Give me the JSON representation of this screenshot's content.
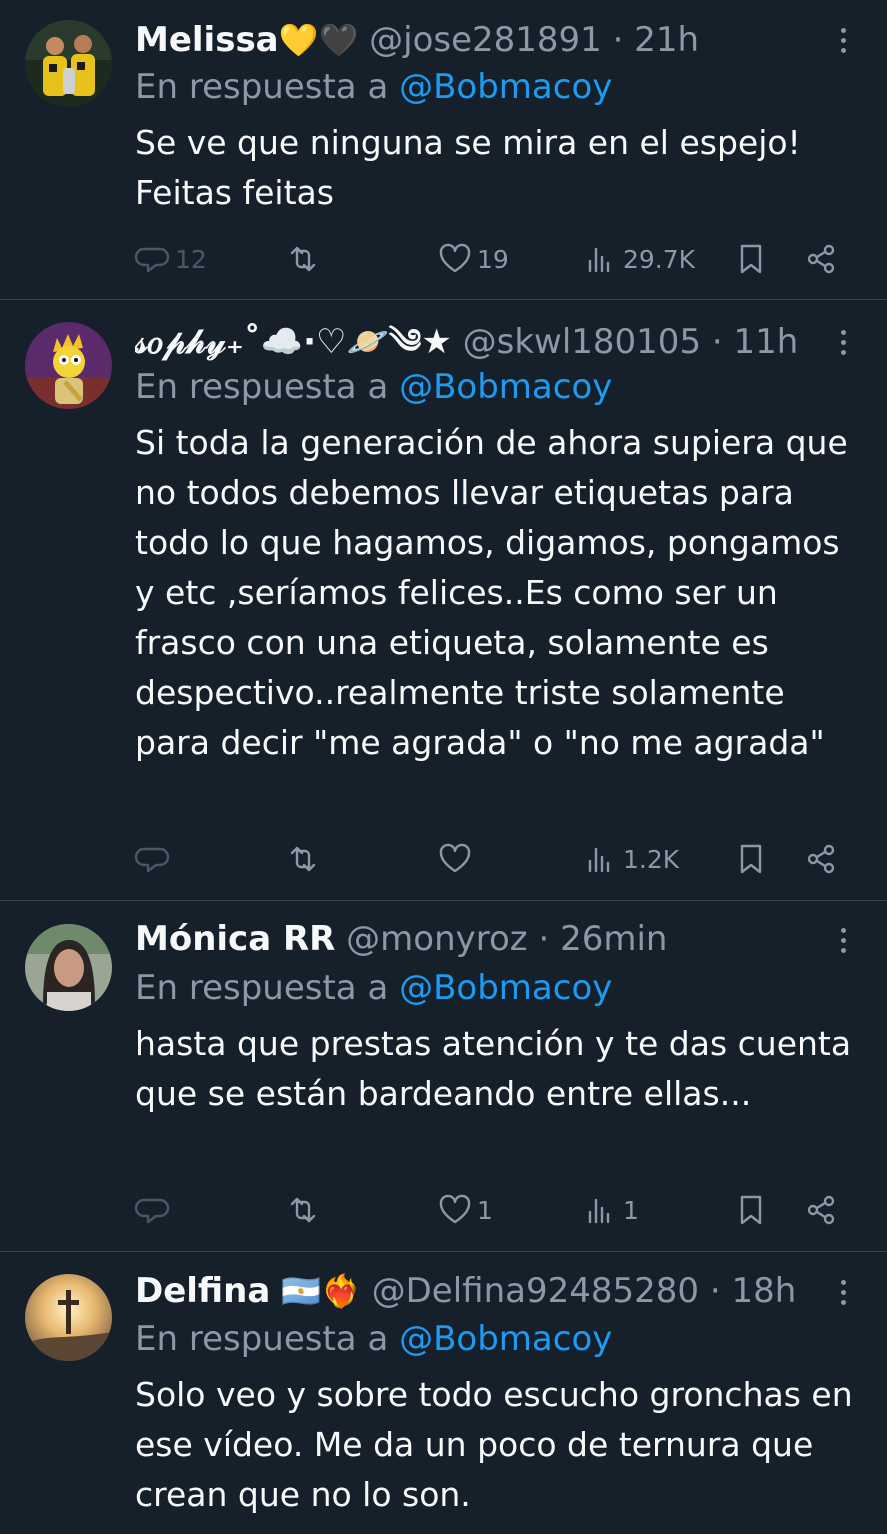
{
  "tweets": [
    {
      "name": "Melissa",
      "name_emoji": "💛🖤",
      "handle": "@jose281891",
      "separator": "·",
      "time": "21h",
      "reply_prefix": "En respuesta a",
      "reply_to": "@Bobmacoy",
      "text": "Se ve que ninguna se mira en el espejo! Feitas feitas",
      "replies": "12",
      "retweets": "",
      "likes": "19",
      "views": "29.7K"
    },
    {
      "name": "𝓈𝑜𝓅𝒽𝓎₊˚☁️·♡🪐༄★",
      "name_emoji": "",
      "handle": "@skwl180105",
      "separator": "·",
      "time": "11h",
      "reply_prefix": "En respuesta a",
      "reply_to": "@Bobmacoy",
      "text": "Si toda la generación de ahora supiera que no todos debemos llevar etiquetas para todo lo que hagamos, digamos, pongamos y etc ,seríamos felices..Es como ser un frasco con una etiqueta, solamente es despectivo..realmente triste solamente para decir \"me agrada\" o \"no me agrada\"",
      "replies": "",
      "retweets": "",
      "likes": "",
      "views": "1.2K"
    },
    {
      "name": "Mónica RR",
      "name_emoji": "",
      "handle": "@monyroz",
      "separator": "·",
      "time": "26min",
      "reply_prefix": "En respuesta a",
      "reply_to": "@Bobmacoy",
      "text": "hasta que prestas atención y te das cuenta que se están bardeando entre ellas...",
      "replies": "",
      "retweets": "",
      "likes": "1",
      "views": "1"
    },
    {
      "name": "Delfina",
      "name_emoji": "🇦🇷❤️‍🔥",
      "handle": "@Delfina92485280",
      "separator": "·",
      "time": "18h",
      "reply_prefix": "En respuesta a",
      "reply_to": "@Bobmacoy",
      "text": "Solo veo y sobre todo escucho gronchas en ese vídeo. Me da un poco de ternura que crean que no lo son.",
      "replies": "",
      "retweets": "",
      "likes": "",
      "views": ""
    }
  ],
  "icons": {
    "reply": "speech-bubble-icon",
    "retweet": "retweet-icon",
    "like": "heart-icon",
    "views": "bar-chart-icon",
    "bookmark": "bookmark-icon",
    "share": "share-icon",
    "more": "more-dots-icon"
  },
  "colors": {
    "background": "#15202b",
    "text": "#f7f9f9",
    "secondary": "#8b98a5",
    "link": "#1d9bf0",
    "divider": "#38444d"
  }
}
